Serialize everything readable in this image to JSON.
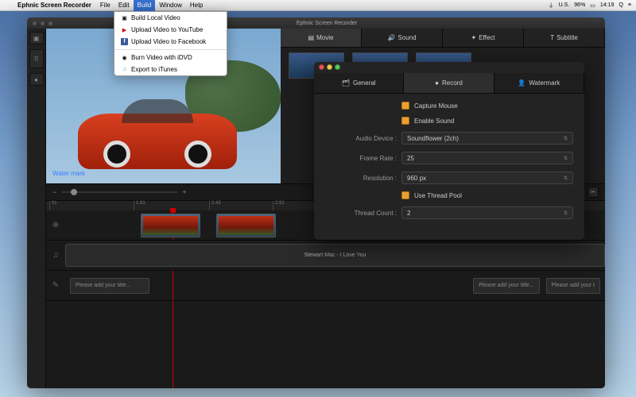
{
  "menubar": {
    "app": "Ephnic Screen Recorder",
    "items": [
      "File",
      "Edit",
      "Build",
      "Window",
      "Help"
    ],
    "active": "Build",
    "status": {
      "flag": "U.S.",
      "battery": "96%",
      "time": "14:19"
    }
  },
  "dropdown": {
    "items": [
      {
        "label": "Build Local Video",
        "icon": "video-icon"
      },
      {
        "label": "Upload Video to YouTube",
        "icon": "youtube-icon"
      },
      {
        "label": "Upload Video to Facebook",
        "icon": "facebook-icon"
      },
      "-",
      {
        "label": "Burn Video with iDVD",
        "icon": "dvd-icon"
      },
      {
        "label": "Export to iTunes",
        "icon": "itunes-icon"
      }
    ]
  },
  "window": {
    "title": "Ephnic Screen Recorder"
  },
  "preview": {
    "watermark": "Water mark"
  },
  "right_tabs": [
    {
      "label": "Movie",
      "icon": "movie-icon",
      "active": true
    },
    {
      "label": "Sound",
      "icon": "sound-icon"
    },
    {
      "label": "Effect",
      "icon": "effect-icon"
    },
    {
      "label": "Subtitle",
      "icon": "subtitle-icon"
    }
  ],
  "timeline": {
    "marks": [
      "0s",
      "1.81",
      "2.42",
      "2.91"
    ],
    "audio_clip": "Stewart Mac - I Love You",
    "title_placeholder": "Please add your title...",
    "title_placeholder2": "Please add your t"
  },
  "settings": {
    "tabs": [
      {
        "label": "General",
        "icon": "general-icon"
      },
      {
        "label": "Record",
        "icon": "record-icon",
        "active": true
      },
      {
        "label": "Watermark",
        "icon": "watermark-icon"
      }
    ],
    "capture_mouse": {
      "label": "Capture Mouse",
      "checked": true
    },
    "enable_sound": {
      "label": "Enable Sound",
      "checked": true
    },
    "audio_device": {
      "label": "Audio Device :",
      "value": "Soundflower (2ch)"
    },
    "frame_rate": {
      "label": "Frame Rate :",
      "value": "25"
    },
    "resolution": {
      "label": "Resolution :",
      "value": "960 px"
    },
    "use_thread_pool": {
      "label": "Use Thread Pool",
      "checked": true
    },
    "thread_count": {
      "label": "Thread Count :",
      "value": "2"
    }
  }
}
